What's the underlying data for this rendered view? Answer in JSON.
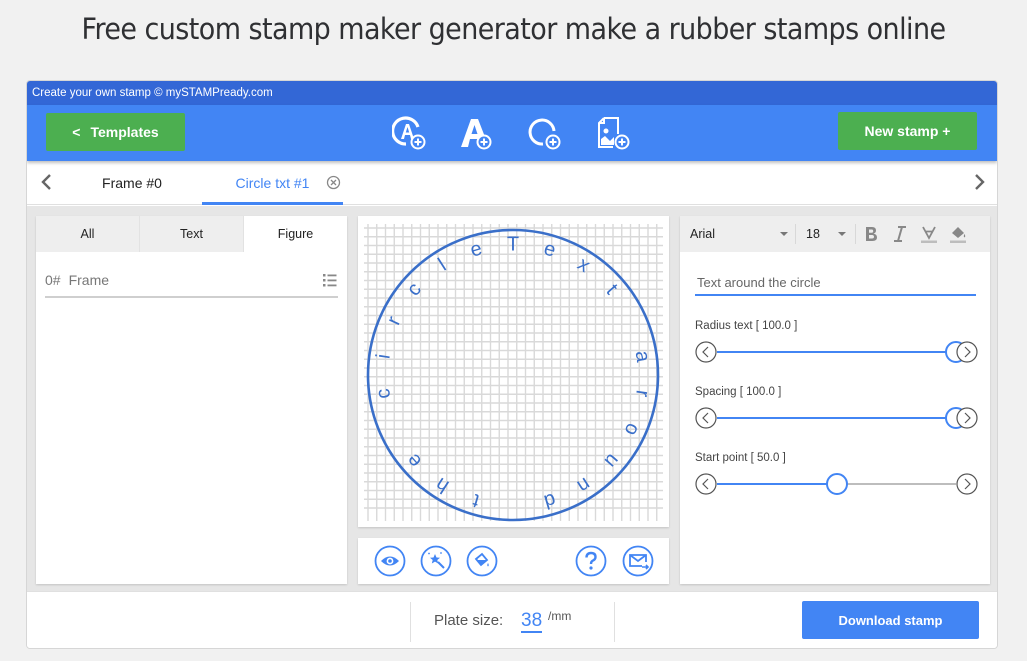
{
  "page": {
    "title": "Free custom stamp maker generator make a rubber stamps online"
  },
  "app": {
    "topbar_text": "Create your own stamp © mySTAMPready.com",
    "toolbar": {
      "templates_label": "Templates",
      "templates_chevron": "<",
      "new_stamp_label": "New stamp +",
      "tools": [
        {
          "name": "add-circle-text-icon",
          "tooltip": "Add circle text"
        },
        {
          "name": "add-text-icon",
          "tooltip": "Add text"
        },
        {
          "name": "add-figure-icon",
          "tooltip": "Add figure"
        },
        {
          "name": "add-image-icon",
          "tooltip": "Add image"
        }
      ]
    },
    "tabs": [
      {
        "label": "Frame #0",
        "active": false
      },
      {
        "label": "Circle txt #1",
        "active": true,
        "closable": true
      }
    ],
    "layers_panel": {
      "filters": [
        {
          "label": "All",
          "active": false
        },
        {
          "label": "Text",
          "active": false
        },
        {
          "label": "Figure",
          "active": true
        }
      ],
      "items": [
        {
          "num": "0#",
          "name": "Frame"
        }
      ]
    },
    "canvas": {
      "circle_text": "Text around the circle",
      "start_letter": "T",
      "colors": {
        "stroke": "#3a6fc9",
        "grid": "#d9d9d9"
      }
    },
    "canvas_tools": [
      {
        "name": "preview-eye-icon"
      },
      {
        "name": "magic-wand-icon"
      },
      {
        "name": "paint-bucket-icon"
      },
      {
        "name": "help-icon"
      },
      {
        "name": "send-email-icon"
      }
    ],
    "properties": {
      "font": "Arial",
      "size": "18",
      "text_value": "Text around the circle",
      "sliders": [
        {
          "label": "Radius text [ 100.0 ]",
          "value": 100.0,
          "max": 100
        },
        {
          "label": "Spacing [ 100.0 ]",
          "value": 100.0,
          "max": 100
        },
        {
          "label": "Start point [ 50.0 ]",
          "value": 50.0,
          "max": 100
        }
      ]
    },
    "bottom": {
      "plate_label": "Plate size:",
      "plate_value": "38",
      "plate_unit": "/mm",
      "download_label": "Download stamp"
    },
    "colors": {
      "primary": "#4285f4",
      "topbar": "#3367d6",
      "green": "#4caf50"
    }
  }
}
